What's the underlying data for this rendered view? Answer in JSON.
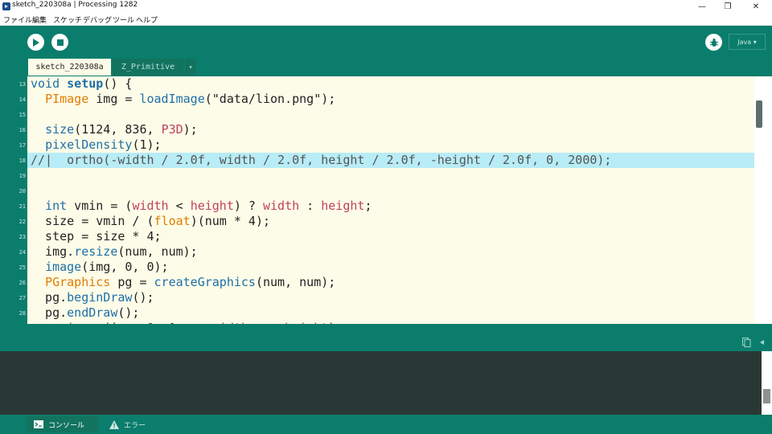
{
  "window": {
    "title": "sketch_220308a | Processing 1282",
    "minimize": "—",
    "maximize": "❐",
    "close": "✕"
  },
  "menu": [
    "ファイル",
    "編集",
    "スケッチ",
    "デバッグ",
    "ツール",
    "ヘルプ"
  ],
  "toolbar": {
    "mode": "Java ▾",
    "run_icon": "play-icon",
    "stop_icon": "stop-icon",
    "debug_icon": "debugger-icon"
  },
  "tabs": [
    {
      "label": "sketch_220308a",
      "active": true
    },
    {
      "label": "Z_Primitive",
      "active": false
    }
  ],
  "tab_menu": "▾",
  "editor": {
    "line_numbers": [
      "13",
      "14",
      "15",
      "16",
      "17",
      "18",
      "19",
      "20",
      "21",
      "22",
      "23",
      "24",
      "25",
      "26",
      "27",
      "28",
      ""
    ],
    "highlighted_line": 18
  },
  "console": {
    "tabs": [
      {
        "label": "コンソール",
        "icon": "console-icon"
      },
      {
        "label": "エラー",
        "icon": "warning-icon"
      }
    ]
  },
  "colors": {
    "chrome": "#0b7d6c",
    "editor_bg": "#fdfce8",
    "highlight": "#b8ecf6",
    "keyword": "#1f6fa8",
    "type": "#e37c00",
    "literal": "#c0405e"
  }
}
